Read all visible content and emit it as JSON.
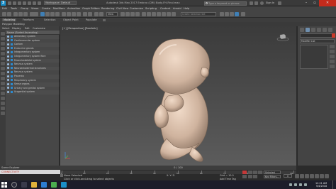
{
  "titlebar": {
    "logo": "3",
    "workspace": "Workspace: Default",
    "title": "Autodesk 3ds Max 2017   Embryo (CMI) Body-FH-Final.max",
    "search_placeholder": "Type a keyword or phrase",
    "signin": "Sign In"
  },
  "menu": {
    "items": [
      "Edit",
      "Tools",
      "Group",
      "Views",
      "Create",
      "Modifiers",
      "Animation",
      "Graph Editors",
      "Rendering",
      "Civil View",
      "Customize",
      "Scripting",
      "Content",
      "Arnold",
      "Help"
    ]
  },
  "toolbar": {
    "view_dropdown": "View",
    "named_selection": "Create Selection Set"
  },
  "ribbon": {
    "tabs": [
      "Modeling",
      "Freeform",
      "Selection",
      "Object Paint",
      "Populate"
    ],
    "active_tab": "Modeling",
    "sub_label": "Polygon Modeling"
  },
  "explorer": {
    "menu": [
      "Select",
      "Display",
      "Edit",
      "Customize"
    ],
    "header": "Name (Sorted Ascending)",
    "rows": [
      "Alimentary system",
      "Cardiovascular system",
      "Coelom",
      "Endocrine glands",
      "Integumentary system",
      "Integumentary system fibre",
      "Musculoskeletal system",
      "Nervous system",
      "Neuroectodermal structures",
      "Nervous system",
      "Placenta",
      "Respiratory system",
      "Sense organs",
      "Urinary and genital system",
      "Urogenital system"
    ],
    "bottom_label": "Scene Explorer"
  },
  "viewport": {
    "label": "[+] [Perspective] [Realistic]"
  },
  "cmdpanel": {
    "modifier_list": "Modifier List"
  },
  "timeline": {
    "slider_label": "0 / 100",
    "ticks": [
      "0",
      "10",
      "20",
      "30",
      "40",
      "50",
      "60",
      "70",
      "80",
      "90",
      "100"
    ]
  },
  "status": {
    "script_label": "Scene Explorer",
    "maxscript": "CONNECTIVITY",
    "line1": "None Selected",
    "line2": "Click or click-and-drag to select objects",
    "coords": "X:   Y:   Z:",
    "grid": "Grid = 10.0",
    "add_time_tag": "Add Time Tag",
    "selected": "Selected",
    "filters": "Key Filters...",
    "frame": "0"
  },
  "taskbar": {
    "time": "12:21 AM",
    "date": "5/4/2018"
  },
  "colors": {
    "accent": "#1a8fc9",
    "object_icon": "#2d8bd0",
    "close": "#c42b1c"
  }
}
